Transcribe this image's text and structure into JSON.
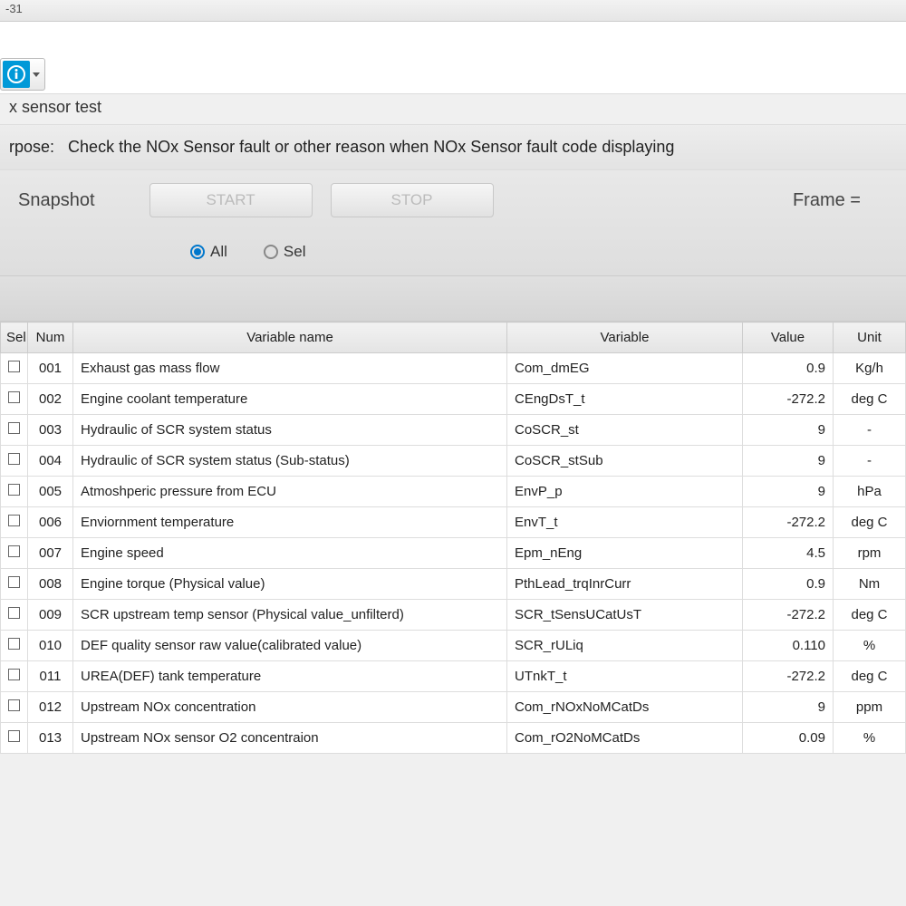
{
  "window": {
    "title_fragment": "-31"
  },
  "page": {
    "title_fragment": "x sensor test",
    "purpose_prefix": "rpose:",
    "purpose_text": "Check the NOx Sensor fault or other reason when NOx Sensor fault code displaying"
  },
  "controls": {
    "snapshot_label": "Snapshot",
    "start_label": "START",
    "stop_label": "STOP",
    "frame_label": "Frame =",
    "radio_all": "All",
    "radio_sel": "Sel",
    "radio_selected": "all"
  },
  "table": {
    "headers": {
      "sel": "Sel",
      "num": "Num",
      "name": "Variable name",
      "var": "Variable",
      "val": "Value",
      "unit": "Unit"
    },
    "rows": [
      {
        "num": "001",
        "name": "Exhaust gas mass flow",
        "var": "Com_dmEG",
        "val": "0.9",
        "unit": "Kg/h"
      },
      {
        "num": "002",
        "name": "Engine coolant temperature",
        "var": "CEngDsT_t",
        "val": "-272.2",
        "unit": "deg C"
      },
      {
        "num": "003",
        "name": "Hydraulic of SCR system status",
        "var": "CoSCR_st",
        "val": "9",
        "unit": "-"
      },
      {
        "num": "004",
        "name": "Hydraulic of SCR system status (Sub-status)",
        "var": "CoSCR_stSub",
        "val": "9",
        "unit": "-"
      },
      {
        "num": "005",
        "name": "Atmoshperic pressure from ECU",
        "var": "EnvP_p",
        "val": "9",
        "unit": "hPa"
      },
      {
        "num": "006",
        "name": "Enviornment temperature",
        "var": "EnvT_t",
        "val": "-272.2",
        "unit": "deg C"
      },
      {
        "num": "007",
        "name": "Engine speed",
        "var": "Epm_nEng",
        "val": "4.5",
        "unit": "rpm"
      },
      {
        "num": "008",
        "name": "Engine torque (Physical value)",
        "var": "PthLead_trqInrCurr",
        "val": "0.9",
        "unit": "Nm"
      },
      {
        "num": "009",
        "name": "SCR upstream temp sensor (Physical value_unfilterd)",
        "var": "SCR_tSensUCatUsT",
        "val": "-272.2",
        "unit": "deg C"
      },
      {
        "num": "010",
        "name": "DEF quality sensor raw value(calibrated value)",
        "var": "SCR_rULiq",
        "val": "0.110",
        "unit": "%"
      },
      {
        "num": "011",
        "name": "UREA(DEF) tank temperature",
        "var": "UTnkT_t",
        "val": "-272.2",
        "unit": "deg C"
      },
      {
        "num": "012",
        "name": "Upstream NOx concentration",
        "var": "Com_rNOxNoMCatDs",
        "val": "9",
        "unit": "ppm"
      },
      {
        "num": "013",
        "name": "Upstream NOx sensor O2 concentraion",
        "var": "Com_rO2NoMCatDs",
        "val": "0.09",
        "unit": "%"
      }
    ]
  }
}
